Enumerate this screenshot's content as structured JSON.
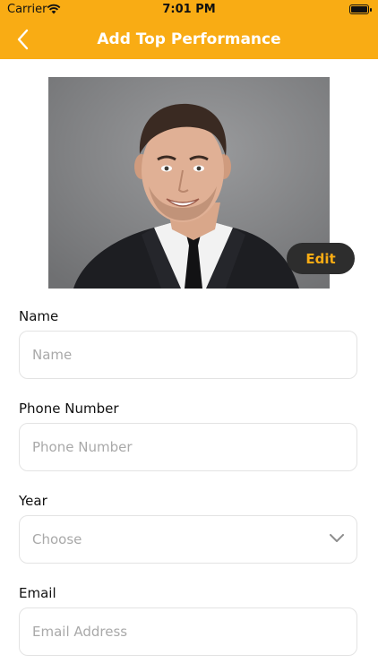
{
  "status_bar": {
    "carrier": "Carrier",
    "time": "7:01 PM"
  },
  "header": {
    "title": "Add Top Performance"
  },
  "photo": {
    "edit_label": "Edit"
  },
  "form": {
    "name": {
      "label": "Name",
      "placeholder": "Name"
    },
    "phone": {
      "label": "Phone Number",
      "placeholder": "Phone Number"
    },
    "year": {
      "label": "Year",
      "value": "Choose"
    },
    "email": {
      "label": "Email",
      "placeholder": "Email Address"
    }
  },
  "colors": {
    "accent": "#F9AC14",
    "edit_button_bg": "#2D2D2D"
  }
}
